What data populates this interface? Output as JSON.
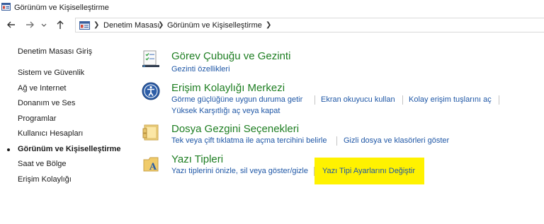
{
  "window": {
    "title": "Görünüm ve Kişiselleştirme"
  },
  "nav": {
    "back_icon": "back-arrow-icon",
    "forward_icon": "forward-arrow-icon",
    "recent_icon": "chevron-down-icon",
    "up_icon": "up-arrow-icon"
  },
  "breadcrumb": {
    "items": [
      "Denetim Masası",
      "Görünüm ve Kişiselleştirme"
    ]
  },
  "sidebar": {
    "home_label": "Denetim Masası Giriş",
    "items": [
      {
        "label": "Sistem ve Güvenlik",
        "active": false
      },
      {
        "label": "Ağ ve Internet",
        "active": false
      },
      {
        "label": "Donanım ve Ses",
        "active": false
      },
      {
        "label": "Programlar",
        "active": false
      },
      {
        "label": "Kullanıcı Hesapları",
        "active": false
      },
      {
        "label": "Görünüm ve Kişiselleştirme",
        "active": true
      },
      {
        "label": "Saat ve Bölge",
        "active": false
      },
      {
        "label": "Erişim Kolaylığı",
        "active": false
      }
    ]
  },
  "categories": [
    {
      "title": "Görev Çubuğu ve Gezinti",
      "icon": "taskbar-icon",
      "links": [
        "Gezinti özellikleri"
      ]
    },
    {
      "title": "Erişim Kolaylığı Merkezi",
      "icon": "ease-of-access-icon",
      "links": [
        "Görme güçlüğüne uygun duruma getir",
        "Ekran okuyucu kullan",
        "Kolay erişim tuşlarını aç",
        "Yüksek Karşıtlığı aç veya kapat"
      ]
    },
    {
      "title": "Dosya Gezgini Seçenekleri",
      "icon": "folder-options-icon",
      "links": [
        "Tek veya çift tıklatma ile açma tercihini belirle",
        "Gizli dosya ve klasörleri göster"
      ]
    },
    {
      "title": "Yazı Tipleri",
      "icon": "fonts-icon",
      "links": [
        "Yazı tiplerini önizle, sil veya göster/gizle",
        "Yazı Tipi Ayarlarını Değiştir"
      ]
    }
  ],
  "colors": {
    "category_title": "#1e7e22",
    "link": "#1f57a6",
    "highlight": "#fff200"
  }
}
